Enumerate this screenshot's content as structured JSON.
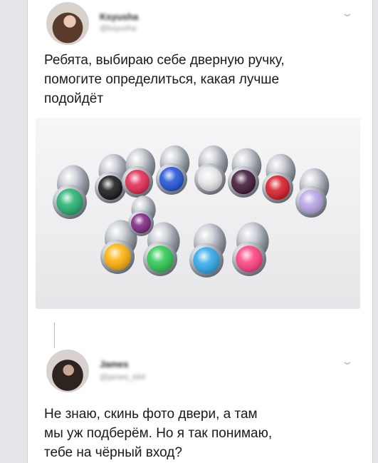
{
  "tweet1": {
    "author_name": "Ksyusha",
    "handle": "@ksyusha",
    "text": "Ребята, выбираю себе дверную ручку,\nпомогите определиться, какая лучше\nподойдёт"
  },
  "photo": {
    "jewel_colors": [
      "#1fae6a",
      "#111111",
      "#e0244b",
      "#1b4fd8",
      "#e8e8ec",
      "#3a1030",
      "#d6141e",
      "#b8a4e6",
      "#ffb000",
      "#27c84c",
      "#2aa7e8",
      "#ff3b7d",
      "#7a1f7c"
    ]
  },
  "tweet2": {
    "author_name": "James",
    "handle": "@james_k84",
    "text": "Не знаю, скинь фото двери, а там\nмы уж подберём. Но я так понимаю,\nтебе на чёрный вход?"
  },
  "icons": {
    "more": "chevron-down-icon"
  }
}
